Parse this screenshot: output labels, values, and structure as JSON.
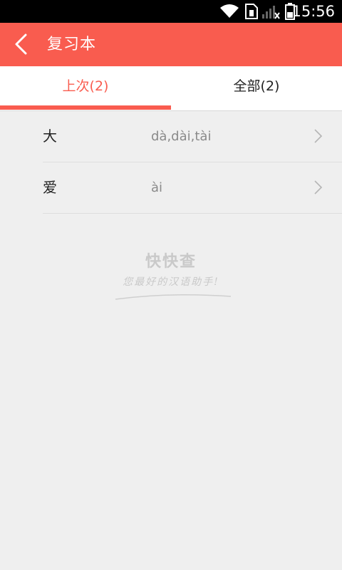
{
  "status_bar": {
    "time": "15:56"
  },
  "app_bar": {
    "title": "复习本"
  },
  "tabs": [
    {
      "label": "上次(2)",
      "selected": true
    },
    {
      "label": "全部(2)",
      "selected": false
    }
  ],
  "list": {
    "items": [
      {
        "character": "大",
        "pinyin": "dà,dài,tài"
      },
      {
        "character": "爱",
        "pinyin": "ài"
      }
    ]
  },
  "watermark": {
    "title": "快快查",
    "slogan": "您最好的汉语助手!"
  },
  "colors": {
    "accent": "#f95c4f",
    "background": "#efefef",
    "status_bar": "#000000"
  }
}
